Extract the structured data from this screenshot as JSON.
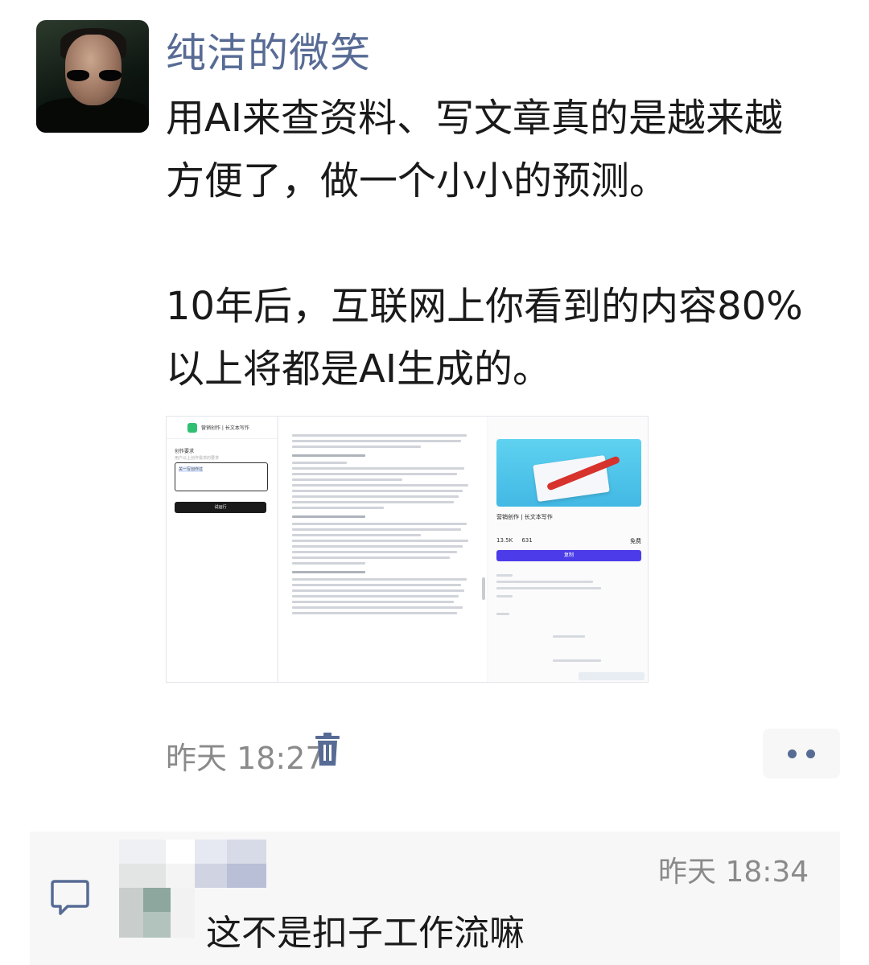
{
  "post": {
    "username": "纯洁的微笑",
    "paragraphs": [
      "用AI来查资料、写文章真的是越来越",
      "方便了，做一个小小的预测。",
      "",
      "10年后，互联网上你看到的内容80%",
      "以上将都是AI生成的。"
    ],
    "timestamp": "昨天 18:27",
    "trash_icon": "trash-icon",
    "more_icon": "more-dots-icon"
  },
  "embedded_screenshot": {
    "app_title": "营销创作 | 长文本写作",
    "input_label": "创作要求",
    "input_hint": "用户以上创作需求的要求",
    "input_value": "关一写创作过",
    "run_button": "试运行",
    "card_title": "营销创作 | 长文本写作",
    "stat_1": "13.5K",
    "stat_2": "631",
    "price": "免费",
    "copy_button": "复制"
  },
  "comment": {
    "timestamp": "昨天 18:34",
    "text": "这不是扣子工作流嘛",
    "comment_icon": "comment-bubble-icon"
  },
  "colors": {
    "name_blue": "#576b95",
    "meta_gray": "#8a8a8a",
    "comment_bg": "#f7f7f7"
  }
}
